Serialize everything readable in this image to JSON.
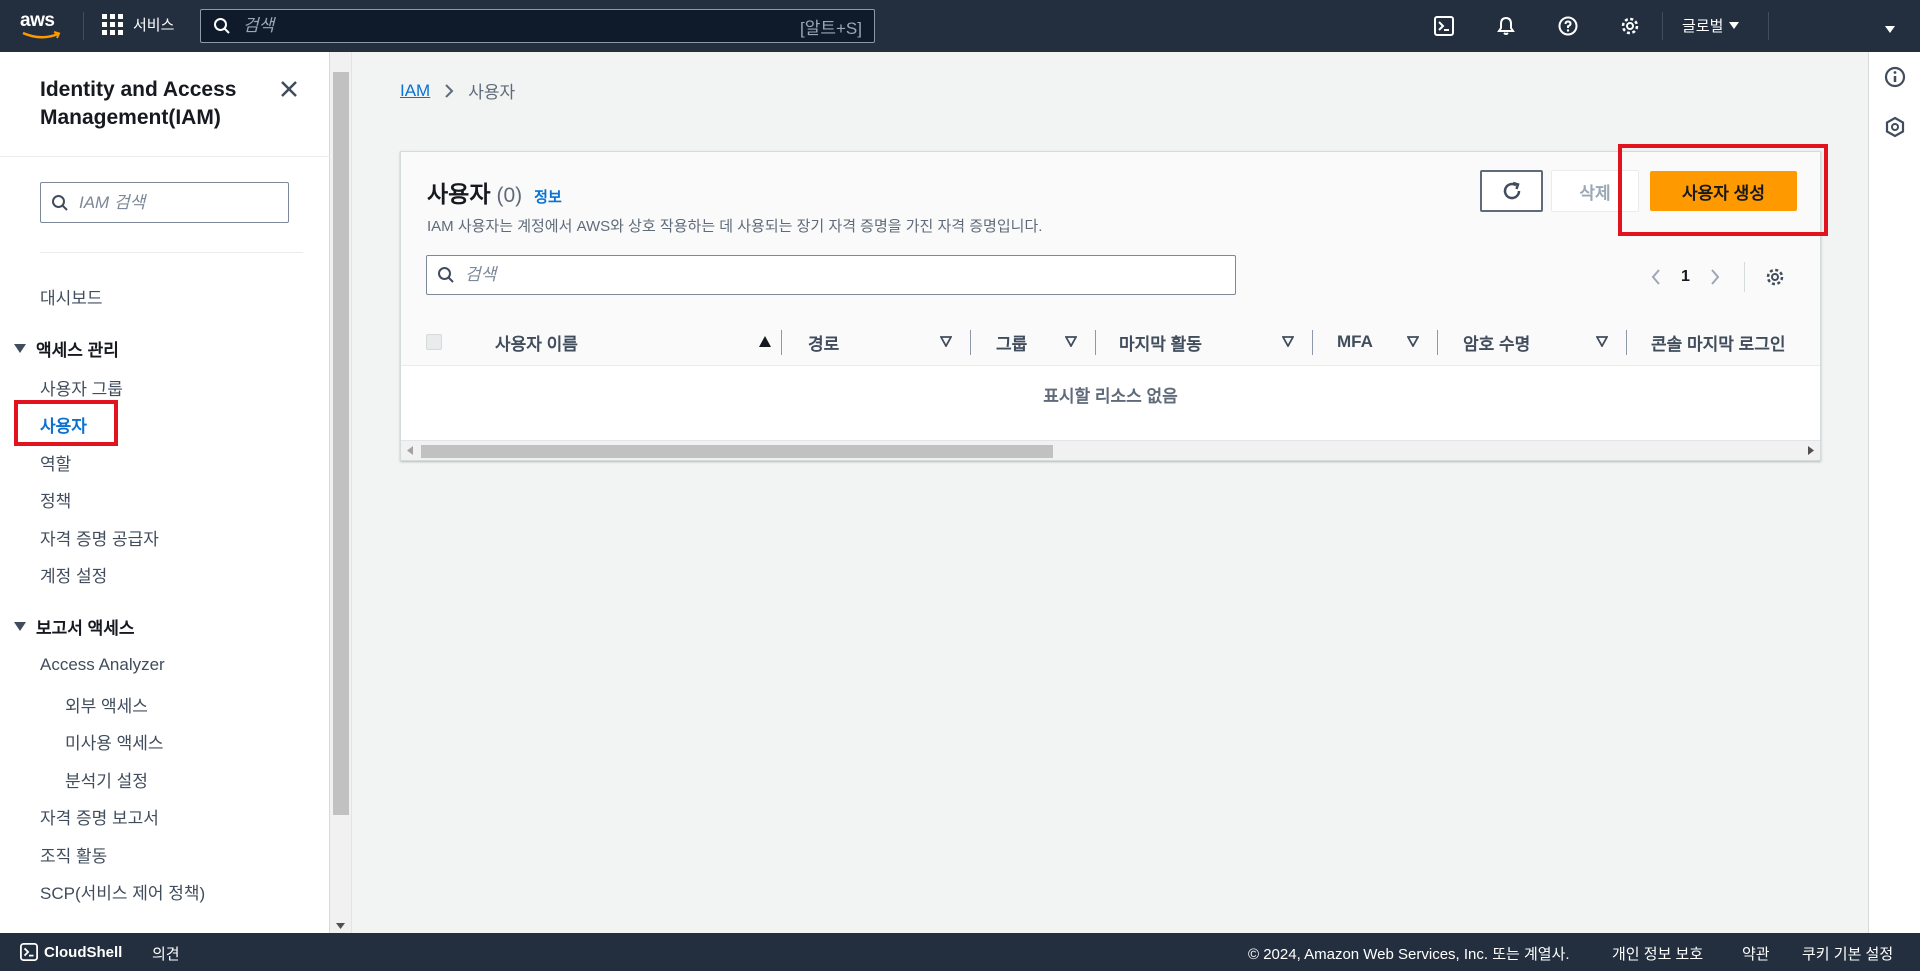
{
  "topnav": {
    "logo": "aws",
    "services_label": "서비스",
    "search_placeholder": "검색",
    "search_shortcut": "[알트+S]",
    "region_label": "글로벌"
  },
  "sidebar": {
    "title_line1": "Identity and Access",
    "title_line2": "Management(IAM)",
    "search_placeholder": "IAM 검색",
    "dashboard": "대시보드",
    "section_access": "액세스 관리",
    "access_items": [
      "사용자 그룹",
      "사용자",
      "역할",
      "정책",
      "자격 증명 공급자",
      "계정 설정"
    ],
    "section_reports": "보고서 액세스",
    "access_analyzer": "Access Analyzer",
    "analyzer_items": [
      "외부 액세스",
      "미사용 액세스",
      "분석기 설정"
    ],
    "report_items": [
      "자격 증명 보고서",
      "조직 활동",
      "SCP(서비스 제어 정책)"
    ]
  },
  "breadcrumb": {
    "root": "IAM",
    "current": "사용자"
  },
  "panel": {
    "title": "사용자",
    "count": "(0)",
    "info": "정보",
    "description": "IAM 사용자는 계정에서 AWS와 상호 작용하는 데 사용되는 장기 자격 증명을 가진 자격 증명입니다.",
    "delete_label": "삭제",
    "create_label": "사용자 생성",
    "search_placeholder": "검색",
    "page": "1",
    "columns": [
      "사용자 이름",
      "경로",
      "그룹",
      "마지막 활동",
      "MFA",
      "암호 수명",
      "콘솔 마지막 로그인"
    ],
    "empty_text": "표시할 리소스 없음"
  },
  "footer": {
    "cloudshell": "CloudShell",
    "feedback": "의견",
    "copyright": "© 2024, Amazon Web Services, Inc. 또는 계열사.",
    "privacy": "개인 정보 보호",
    "terms": "약관",
    "cookies": "쿠키 기본 설정"
  },
  "colors": {
    "nav_bg": "#232f3e",
    "primary_button": "#ff9900",
    "link": "#0972d3",
    "highlight": "#e0131e"
  }
}
